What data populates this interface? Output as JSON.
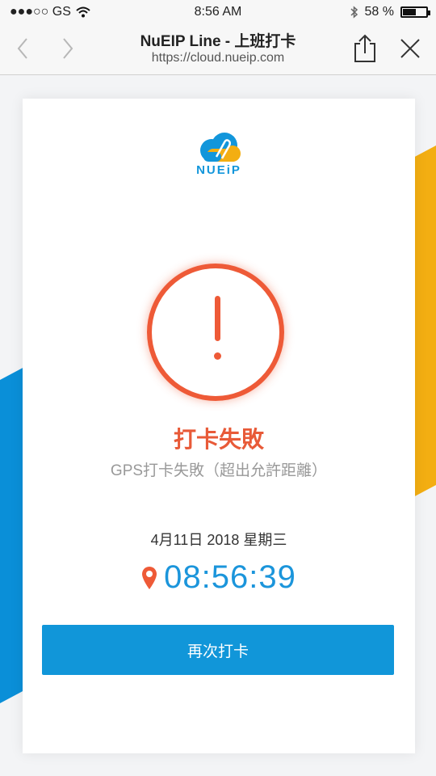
{
  "status_bar": {
    "carrier": "●●●○○ GS",
    "time": "8:56 AM",
    "battery": "58 %",
    "battery_level": 0.58
  },
  "browser": {
    "title": "NuEIP Line - 上班打卡",
    "url": "https://cloud.nueip.com",
    "icons": [
      "back-icon",
      "forward-icon",
      "share-icon",
      "close-icon"
    ]
  },
  "logo": {
    "text": "NUEiP"
  },
  "result": {
    "title": "打卡失敗",
    "subtitle": "GPS打卡失敗（超出允許距離）"
  },
  "date": "4月11日 2018 星期三",
  "clock": "08:56:39",
  "retry_button": "再次打卡",
  "colors": {
    "error": "#ee5a37",
    "primary": "#1196d9",
    "accent_yellow": "#f3ae12",
    "accent_blue": "#0a8fd8"
  }
}
